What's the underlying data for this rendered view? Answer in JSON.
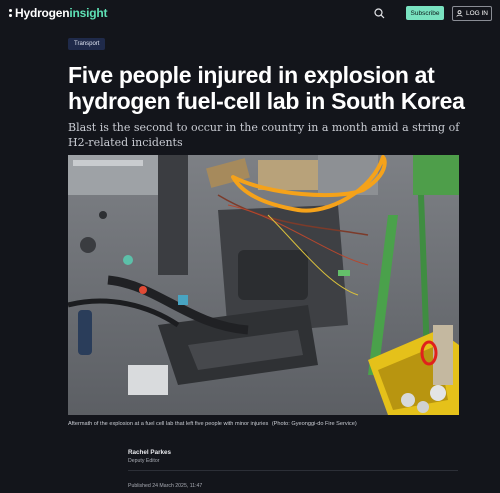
{
  "header": {
    "logo_part1": "Hydrogen",
    "logo_part2": "insight",
    "subscribe_label": "Subscribe",
    "login_label": "LOG IN",
    "icons": [
      "search-icon",
      "user-icon"
    ]
  },
  "article": {
    "category": "Transport",
    "title": "Five people injured in explosion at hydrogen fuel-cell lab in South Korea",
    "subtitle": "Blast is the second to occur in the country in a month amid a string of H2-related incidents",
    "caption": "Aftermath of the explosion at a fuel cell lab that left five people with minor injuries",
    "credit": "(Photo: Gyeonggi-do Fire Service)",
    "author_name": "Rachel Parkes",
    "author_role": "Deputy Editor",
    "published": "Published 24 March 2025, 11:47"
  },
  "colors": {
    "background": "#13151b",
    "accent": "#79e2c0",
    "annotation_orange": "#f5a21a",
    "annotation_red": "#e0211c"
  }
}
